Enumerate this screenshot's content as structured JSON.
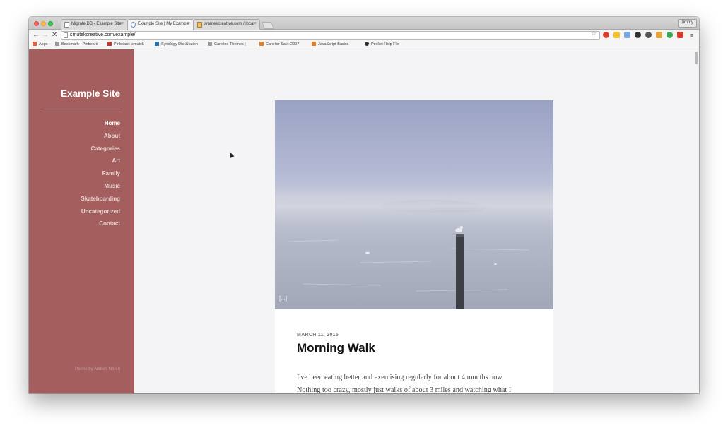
{
  "browser": {
    "tabs": [
      {
        "label": "Migrate DB ‹ Example Site"
      },
      {
        "label": "Example Site | My Example"
      },
      {
        "label": "smutekcreative.com / local"
      }
    ],
    "profile_name": "Jimmy",
    "url": "smutekcreative.com/example/",
    "bookmarks": [
      {
        "label": "Apps",
        "color": "#e85d3a"
      },
      {
        "label": "Bookmark - Pinboard",
        "color": "#9a9a9a"
      },
      {
        "label": "Pinboard: smutek",
        "color": "#c0392b"
      },
      {
        "label": "Synology DiskStation",
        "color": "#2a6fb0"
      },
      {
        "label": "Caroline Themes |",
        "color": "#9a9a9a"
      },
      {
        "label": "Cars for Sale: 2007",
        "color": "#e67e22"
      },
      {
        "label": "JavaScript Basics",
        "color": "#e67e22"
      },
      {
        "label": "Pocket Help File -",
        "color": "#333333"
      }
    ],
    "extension_colors": [
      "#e03c31",
      "#f2c230",
      "#7aa7e0",
      "#333333",
      "#555555",
      "#e8a33d",
      "#3aa655",
      "#d83b2b"
    ]
  },
  "site": {
    "title": "Example Site",
    "menu": [
      "Home",
      "About",
      "Categories",
      "Art",
      "Family",
      "Music",
      "Skateboarding",
      "Uncategorized",
      "Contact"
    ],
    "current_menu": "Home",
    "credit": "Theme by Anders Norén",
    "sidebar_color": "#a45e5e"
  },
  "post": {
    "date": "March 11, 2015",
    "title": "Morning Walk",
    "caption_mark": "[...]",
    "body_lines": [
      "I've been eating better and exercising regularly for about 4 months now.",
      "Nothing too crazy, mostly just walks of about 3 miles and watching what I"
    ]
  }
}
